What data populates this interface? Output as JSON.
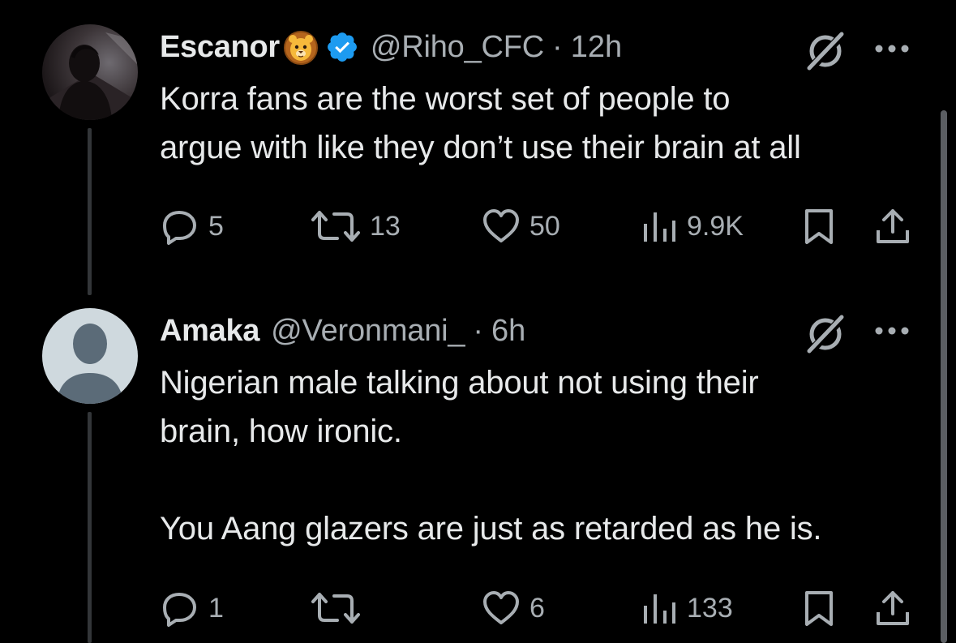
{
  "colors": {
    "background": "#000000",
    "text_primary": "#e7e9ea",
    "text_secondary": "#a8aeb3",
    "thread_line": "#333639",
    "verified_badge": "#1d9bf0"
  },
  "tweets": [
    {
      "name": "Escanor",
      "name_emoji": "lion-face-emoji",
      "verified": true,
      "handle": "@Riho_CFC",
      "separator": "·",
      "time": "12h",
      "text": "Korra fans are the worst set of people to\nargue with like they don’t use their brain at all",
      "avatar": "photo-silhouette-avatar",
      "actions": {
        "replies": "5",
        "reposts": "13",
        "likes": "50",
        "views": "9.9K"
      }
    },
    {
      "name": "Amaka",
      "verified": false,
      "handle": "@Veronmani_",
      "separator": "·",
      "time": "6h",
      "text": "Nigerian male talking about not using their\nbrain, how ironic.\n\nYou Aang glazers are just as retarded as he is.",
      "avatar": "default-profile-avatar",
      "actions": {
        "replies": "1",
        "reposts": "",
        "likes": "6",
        "views": "133"
      }
    }
  ]
}
